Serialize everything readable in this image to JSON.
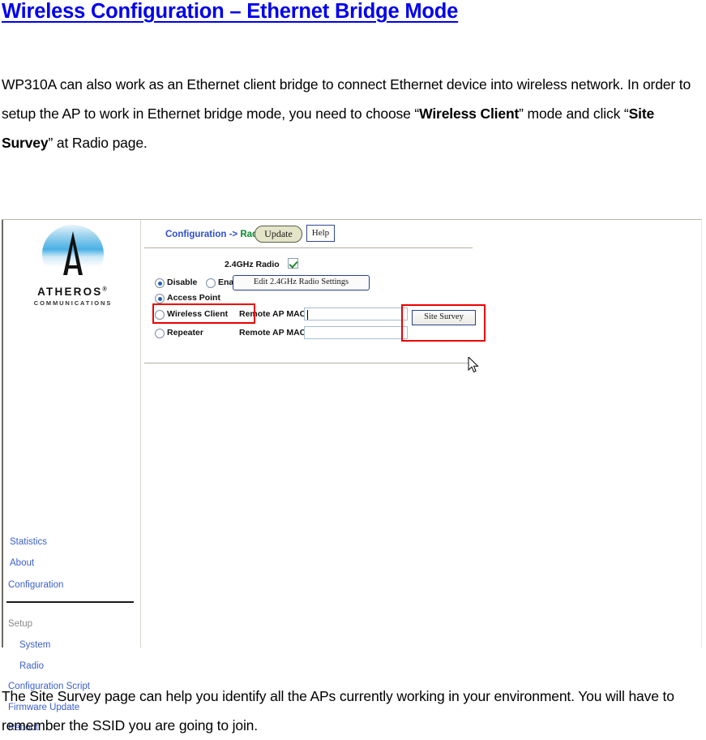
{
  "document": {
    "title": "Wireless Configuration –  Ethernet Bridge Mode",
    "paragraph_1_part_1": "WP310A can also work as an Ethernet client bridge to connect Ethernet device into wireless network. In order to setup the AP to work in Ethernet bridge mode, you need to choose “",
    "paragraph_1_bold_1": "Wireless Client",
    "paragraph_1_part_2": "” mode and click “",
    "paragraph_1_bold_2": "Site Survey",
    "paragraph_1_part_3": "” at Radio page.",
    "paragraph_2": "The Site Survey page can help you identify all the APs currently working in your environment. You will have to remember the SSID you are going to join."
  },
  "screenshot": {
    "logo": {
      "wordmark": "ATHEROS",
      "registered": "®",
      "tagline": "COMMUNICATIONS"
    },
    "sidebar": {
      "links": [
        {
          "label": "Statistics"
        },
        {
          "label": "About"
        },
        {
          "label": "Configuration"
        }
      ],
      "section_header": "Setup",
      "setup_links": [
        {
          "label": "System"
        },
        {
          "label": "Radio"
        },
        {
          "label": "Configuration Script"
        },
        {
          "label": "Firmware Update"
        },
        {
          "label": "Reboot"
        }
      ]
    },
    "main": {
      "breadcrumb_root": "Configuration",
      "breadcrumb_arrow": "->",
      "breadcrumb_current": "Radio",
      "update_button": "Update",
      "help_button": "Help",
      "radio_band_label": "2.4GHz Radio",
      "radio_band_checked": true,
      "state_options": [
        {
          "label": "Disable",
          "selected": true
        },
        {
          "label": "Enable",
          "selected": false
        }
      ],
      "edit_settings_button": "Edit 2.4GHz Radio Settings",
      "mode_options": [
        {
          "label": "Access Point",
          "selected": true
        },
        {
          "label": "Wireless Client",
          "selected": false
        },
        {
          "label": "Repeater",
          "selected": false
        }
      ],
      "remote_mac_label_client": "Remote AP MAC",
      "remote_mac_value_client": "",
      "remote_mac_label_repeater": "Remote AP MAC",
      "remote_mac_value_repeater": "",
      "site_survey_button": "Site Survey"
    },
    "annotations": {
      "highlight_color": "#ee0000",
      "highlighted_items": [
        "Wireless Client",
        "Site Survey"
      ]
    }
  },
  "colors": {
    "heading_link": "#0000ee",
    "nav_link": "#3a5fcd",
    "breadcrumb_root": "#2f4fd0",
    "breadcrumb_current": "#0a8a2a",
    "update_button_fill": "#e4e4c8",
    "checkbox_check": "#1f8a2e"
  }
}
